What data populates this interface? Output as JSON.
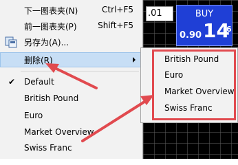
{
  "trade": {
    "lot_value": ".01",
    "buy_label": "BUY",
    "price_small": "0.90",
    "price_big": "14",
    "price_sup": "6"
  },
  "menu": {
    "items": [
      {
        "label": "下一图表夹(N)",
        "shortcut": "Ctrl+F5"
      },
      {
        "label": "前一图表夹(P)",
        "shortcut": "Shift+F5"
      },
      {
        "label": "另存为(A)...",
        "icon": "save-icon"
      },
      {
        "label": "删除(R)",
        "has_submenu": true
      }
    ],
    "profiles": [
      {
        "label": "Default",
        "checked": true
      },
      {
        "label": "British Pound"
      },
      {
        "label": "Euro"
      },
      {
        "label": "Market Overview"
      },
      {
        "label": "Swiss Franc"
      }
    ]
  },
  "submenu": {
    "items": [
      {
        "label": "British Pound"
      },
      {
        "label": "Euro"
      },
      {
        "label": "Market Overview"
      },
      {
        "label": "Swiss Franc"
      }
    ]
  },
  "colors": {
    "highlight": "#c7def5",
    "annotation_red": "#e14a4f",
    "buy_blue": "#1f3fd6"
  }
}
